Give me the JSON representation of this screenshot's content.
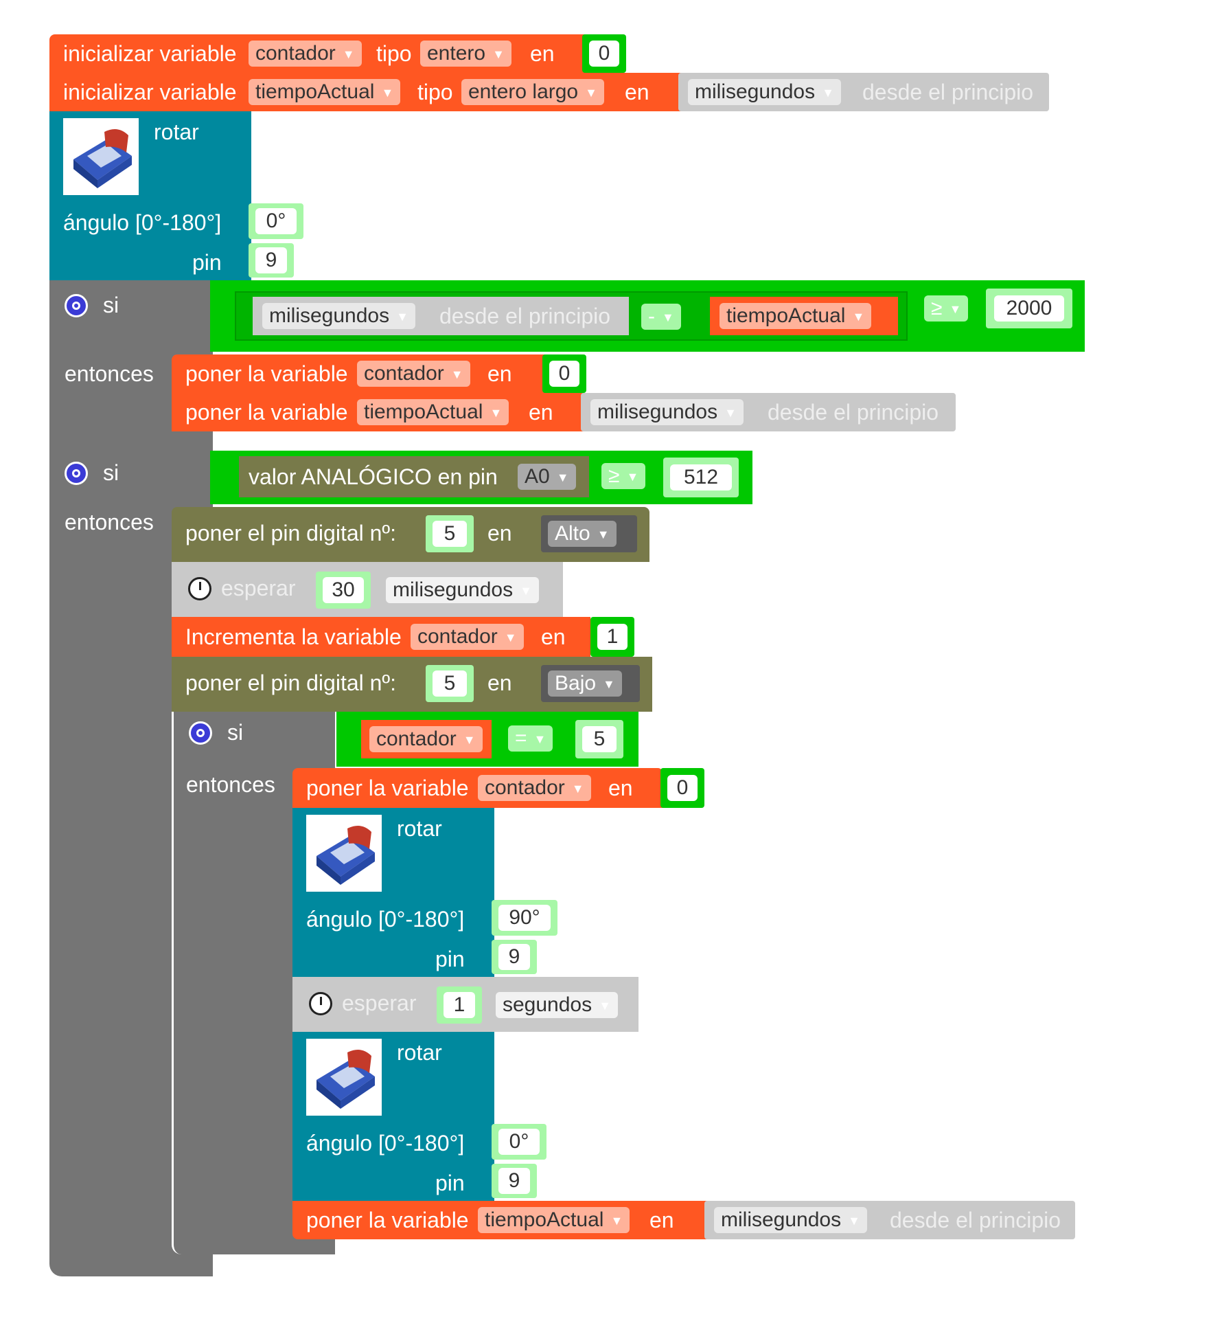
{
  "init1": {
    "label": "inicializar variable",
    "var": "contador",
    "tipo_label": "tipo",
    "tipo": "entero",
    "en_label": "en",
    "value": "0"
  },
  "init2": {
    "label": "inicializar variable",
    "var": "tiempoActual",
    "tipo_label": "tipo",
    "tipo": "entero largo",
    "en_label": "en",
    "unit": "milisegundos",
    "desde": "desde el principio"
  },
  "servo1": {
    "rotar": "rotar",
    "angulo_label": "ángulo [0°-180°]",
    "angle": "0°",
    "pin_label": "pin",
    "pin": "9"
  },
  "if1": {
    "si": "si",
    "entonces": "entonces",
    "cond": {
      "unit": "milisegundos",
      "desde": "desde el principio",
      "op": "-",
      "var": "tiempoActual",
      "cmp": "≥",
      "value": "2000"
    },
    "set1": {
      "label": "poner la variable",
      "var": "contador",
      "en": "en",
      "value": "0"
    },
    "set2": {
      "label": "poner la variable",
      "var": "tiempoActual",
      "en": "en",
      "unit": "milisegundos",
      "desde": "desde el principio"
    }
  },
  "if2": {
    "si": "si",
    "entonces": "entonces",
    "cond": {
      "label": "valor ANALÓGICO en pin",
      "pin": "A0",
      "cmp": "≥",
      "value": "512"
    },
    "dw1": {
      "label": "poner el pin digital nº:",
      "pin": "5",
      "en": "en",
      "state": "Alto"
    },
    "wait1": {
      "label": "esperar",
      "value": "30",
      "unit": "milisegundos"
    },
    "inc": {
      "label": "Incrementa la variable",
      "var": "contador",
      "en": "en",
      "value": "1"
    },
    "dw2": {
      "label": "poner el pin digital nº:",
      "pin": "5",
      "en": "en",
      "state": "Bajo"
    },
    "if3": {
      "si": "si",
      "entonces": "entonces",
      "cond": {
        "var": "contador",
        "op": "=",
        "value": "5"
      },
      "set": {
        "label": "poner la variable",
        "var": "contador",
        "en": "en",
        "value": "0"
      },
      "servo2": {
        "rotar": "rotar",
        "angulo_label": "ángulo [0°-180°]",
        "angle": "90°",
        "pin_label": "pin",
        "pin": "9"
      },
      "wait2": {
        "label": "esperar",
        "value": "1",
        "unit": "segundos"
      },
      "servo3": {
        "rotar": "rotar",
        "angulo_label": "ángulo [0°-180°]",
        "angle": "0°",
        "pin_label": "pin",
        "pin": "9"
      },
      "set2": {
        "label": "poner la variable",
        "var": "tiempoActual",
        "en": "en",
        "unit": "milisegundos",
        "desde": "desde el principio"
      }
    }
  }
}
